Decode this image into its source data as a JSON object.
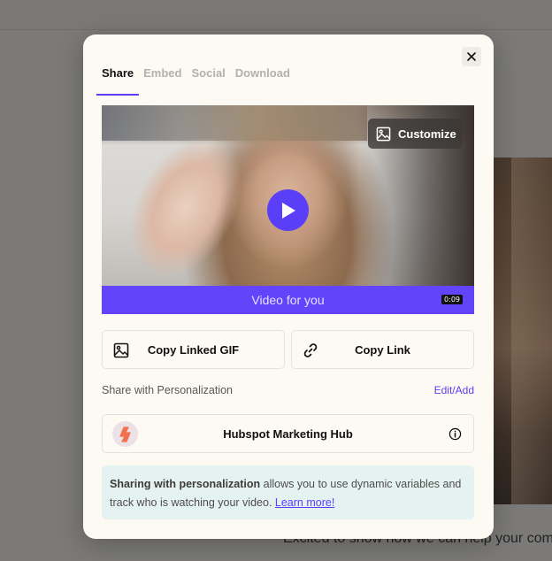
{
  "background": {
    "caption": "Excited to show how we can help your com"
  },
  "modal": {
    "tabs": [
      {
        "label": "Share",
        "active": true
      },
      {
        "label": "Embed",
        "active": false
      },
      {
        "label": "Social",
        "active": false
      },
      {
        "label": "Download",
        "active": false
      }
    ],
    "close_icon": "close-icon",
    "video": {
      "customize_label": "Customize",
      "title": "Video for you",
      "duration": "0:09",
      "accent_color": "#6244fa"
    },
    "actions": {
      "copy_gif_label": "Copy Linked GIF",
      "copy_link_label": "Copy Link"
    },
    "personalization": {
      "label": "Share with Personalization",
      "edit_label": "Edit/Add",
      "integration_name": "Hubspot Marketing Hub"
    },
    "note": {
      "bold": "Sharing with personalization",
      "text": " allows you to use dynamic variables and track who is watching your video. ",
      "link": "Learn more!"
    }
  }
}
